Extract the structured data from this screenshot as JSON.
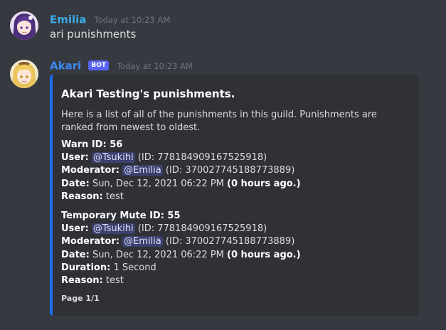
{
  "messages": [
    {
      "author": "Emilia",
      "timestamp": "Today at 10:23 AM",
      "content": "ari punishments"
    },
    {
      "author": "Akari",
      "bot_tag": "BOT",
      "timestamp": "Today at 10:23 AM",
      "embed": {
        "title": "Akari Testing's punishments.",
        "description": "Here is a list of all of the punishments in this guild. Punishments are ranked from newest to oldest.",
        "fields": [
          {
            "name": "Warn ID: 56",
            "user_label": "User:",
            "user_mention": "@Tsukihi",
            "user_id": "(ID: 778184909167525918)",
            "moderator_label": "Moderator:",
            "moderator_mention": "@Emilia",
            "moderator_id": "(ID: 370027745188773889)",
            "date_label": "Date:",
            "date_value": "Sun, Dec 12, 2021 06:22 PM",
            "date_ago": "(0 hours ago.)",
            "reason_label": "Reason:",
            "reason_value": "test"
          },
          {
            "name": "Temporary Mute ID: 55",
            "user_label": "User:",
            "user_mention": "@Tsukihi",
            "user_id": "(ID: 778184909167525918)",
            "moderator_label": "Moderator:",
            "moderator_mention": "@Emilia",
            "moderator_id": "(ID: 370027745188773889)",
            "date_label": "Date:",
            "date_value": "Sun, Dec 12, 2021 06:22 PM",
            "date_ago": "(0 hours ago.)",
            "duration_label": "Duration:",
            "duration_value": "1 Second",
            "reason_label": "Reason:",
            "reason_value": "test"
          }
        ],
        "footer": "Page 1/1",
        "accent_color": "#1a6ef5"
      }
    }
  ],
  "colors": {
    "background": "#36393f",
    "embed_background": "#2f3136",
    "emilia_name": "#3ba9e6",
    "akari_name": "#3b8af0",
    "bot_tag": "#5865f2",
    "timestamp": "#72767d"
  }
}
